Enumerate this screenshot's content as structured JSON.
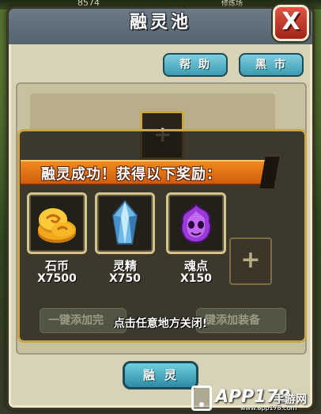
{
  "window": {
    "title": "融灵池",
    "close_label": "X",
    "help_label": "帮助",
    "market_label": "黑市",
    "fuse_label": "融灵"
  },
  "hud": {
    "value_left": "8574",
    "value_right": "修炼场"
  },
  "popup": {
    "banner_text": "融灵成功！获得以下奖励：",
    "rewards": [
      {
        "name": "石币",
        "quantity": "X7500",
        "icon": "coin-stack-icon"
      },
      {
        "name": "灵精",
        "quantity": "X750",
        "icon": "crystal-icon"
      },
      {
        "name": "魂点",
        "quantity": "X150",
        "icon": "purple-soul-icon"
      }
    ],
    "dismiss_text": "点击任意地方关闭!"
  },
  "underlying": {
    "left_button": "一键添加完",
    "right_button": "键添加装备"
  },
  "watermark": {
    "main": "APP178",
    "sub": "手游网",
    "url": "www.app178.com"
  },
  "colors": {
    "banner": "#e67818",
    "tab_button": "#4aa8c0",
    "close_button": "#c8382a",
    "frame_gold": "#c8a648"
  }
}
